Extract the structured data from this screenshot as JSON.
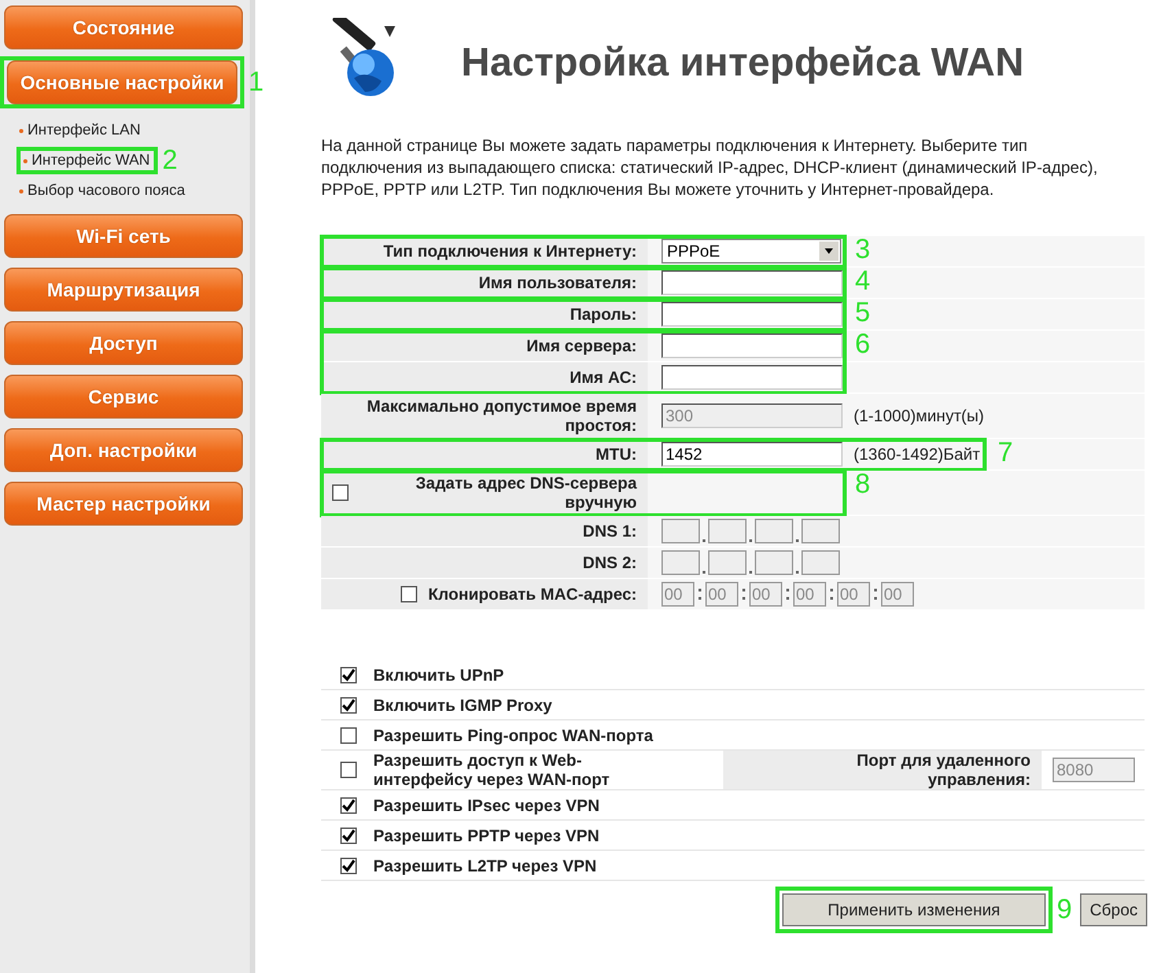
{
  "sidebar": {
    "items": [
      {
        "label": "Состояние"
      },
      {
        "label": "Основные настройки",
        "callout": "1",
        "children": [
          {
            "label": "Интерфейс LAN"
          },
          {
            "label": "Интерфейс WAN",
            "callout": "2"
          },
          {
            "label": "Выбор часового пояса"
          }
        ]
      },
      {
        "label": "Wi-Fi сеть"
      },
      {
        "label": "Маршрутизация"
      },
      {
        "label": "Доступ"
      },
      {
        "label": "Сервис"
      },
      {
        "label": "Доп. настройки"
      },
      {
        "label": "Мастер настройки"
      }
    ]
  },
  "page": {
    "title": "Настройка интерфейса WAN",
    "description": "На данной странице Вы можете задать параметры подключения к Интернету. Выберите тип подключения из выпадающего списка: статический IP-адрес, DHCP-клиент (динамический IP-адрес), PPPoE, PPTP или L2TP. Тип подключения Вы можете уточнить у Интернет-провайдера."
  },
  "form": {
    "groups": [
      {
        "callout": "3",
        "rows": [
          {
            "kind": "select",
            "label": "Тип подключения к Интернету:",
            "value": "PPPoE"
          }
        ]
      },
      {
        "callout": "4",
        "rows": [
          {
            "kind": "text",
            "label": "Имя пользователя:"
          }
        ]
      },
      {
        "callout": "5",
        "rows": [
          {
            "kind": "text",
            "label": "Пароль:"
          }
        ]
      },
      {
        "callout": "6",
        "rows": [
          {
            "kind": "text",
            "label": "Имя сервера:"
          },
          {
            "kind": "text",
            "label": "Имя АС:"
          }
        ]
      },
      {
        "rows": [
          {
            "kind": "text",
            "label": "Максимально допустимое время простоя:",
            "value": "300",
            "disabled": true,
            "hint": "(1-1000)минут(ы)"
          }
        ]
      },
      {
        "callout": "7",
        "rows": [
          {
            "kind": "text",
            "label": "MTU:",
            "value": "1452",
            "disabled": false,
            "hint": "(1360-1492)Байт"
          }
        ]
      },
      {
        "callout": "8",
        "rows": [
          {
            "kind": "checkbox",
            "label": "Задать адрес DNS-сервера вручную",
            "checked": false
          }
        ]
      },
      {
        "rows": [
          {
            "kind": "ip",
            "label": "DNS 1:"
          },
          {
            "kind": "ip",
            "label": "DNS 2:"
          }
        ]
      },
      {
        "rows": [
          {
            "kind": "mac",
            "label": "Клонировать MAC-адрес:",
            "checked": false,
            "values": [
              "00",
              "00",
              "00",
              "00",
              "00",
              "00"
            ]
          }
        ]
      }
    ]
  },
  "options": [
    {
      "kind": "check",
      "label": "Включить UPnP",
      "checked": true
    },
    {
      "kind": "check",
      "label": "Включить IGMP Proxy",
      "checked": true
    },
    {
      "kind": "check",
      "label": "Разрешить Ping-опрос WAN-порта",
      "checked": false
    },
    {
      "kind": "port",
      "label": "Разрешить доступ к Web-интерфейсу через WAN-порт",
      "checked": false,
      "port_label": "Порт для удаленного управления:",
      "port_value": "8080"
    },
    {
      "kind": "check",
      "label": "Разрешить IPsec через VPN",
      "checked": true
    },
    {
      "kind": "check",
      "label": "Разрешить PPTP через VPN",
      "checked": true
    },
    {
      "kind": "check",
      "label": "Разрешить L2TP через VPN",
      "checked": true
    }
  ],
  "buttons": [
    {
      "label": "Применить изменения",
      "kind": "apply",
      "callout": "9"
    },
    {
      "label": "Сброс",
      "kind": "reset"
    }
  ]
}
